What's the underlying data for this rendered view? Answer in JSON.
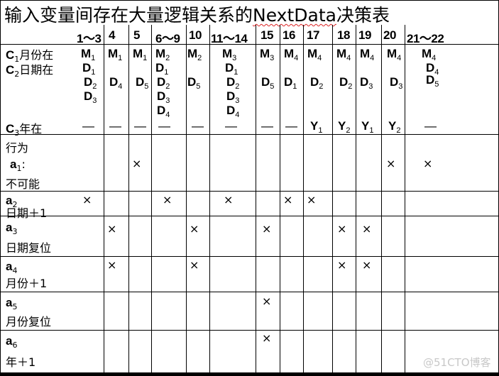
{
  "title": {
    "prefix": "输入变量间存在大量逻辑关系的",
    "keyword": "NextData",
    "suffix": "决策表"
  },
  "rules": [
    "1～3",
    "4",
    "5",
    "6～9",
    "10",
    "11～14",
    "15",
    "16",
    "17",
    "18",
    "19",
    "20",
    "21～22"
  ],
  "conditions": {
    "c1": {
      "id": "C",
      "sub": "1",
      "text": "月份在"
    },
    "c2": {
      "id": "C",
      "sub": "2",
      "text": "日期在"
    },
    "c3": {
      "id": "C",
      "sub": "3",
      "text": "年在"
    },
    "month": [
      [
        "M1"
      ],
      [
        "M1"
      ],
      [
        "M1"
      ],
      [
        "M2"
      ],
      [
        "M2"
      ],
      [
        "M3"
      ],
      [
        "M3"
      ],
      [
        "M4"
      ],
      [
        "M4"
      ],
      [
        "M4"
      ],
      [
        "M4"
      ],
      [
        "M4"
      ],
      [
        "M4"
      ]
    ],
    "day": [
      [
        "D1",
        "D2",
        "D3"
      ],
      [
        "D4"
      ],
      [
        "D5"
      ],
      [
        "D1",
        "D2",
        "D3",
        "D4"
      ],
      [
        "D5"
      ],
      [
        "D1",
        "D2",
        "D3",
        "D4"
      ],
      [
        "D5"
      ],
      [
        "D1"
      ],
      [
        "D2"
      ],
      [
        "D2"
      ],
      [
        "D3"
      ],
      [
        "D3"
      ],
      [
        "D4",
        "D5"
      ]
    ],
    "year": [
      "—",
      "—",
      "—",
      "—",
      "—",
      "—",
      "—",
      "—",
      "Y1",
      "Y2",
      "Y1",
      "Y2",
      "—"
    ]
  },
  "actions_header": "行为",
  "actions": [
    {
      "id": "a",
      "sub": "1",
      "text": "不可能",
      "suffix": ":",
      "marks": [
        false,
        false,
        true,
        false,
        false,
        false,
        false,
        false,
        false,
        false,
        false,
        true,
        true
      ]
    },
    {
      "id": "a",
      "sub": "2",
      "text": "日期＋1",
      "marks": [
        true,
        false,
        false,
        true,
        false,
        true,
        false,
        true,
        true,
        false,
        false,
        false,
        false
      ]
    },
    {
      "id": "a",
      "sub": "3",
      "text": "日期复位",
      "marks": [
        false,
        true,
        false,
        false,
        true,
        false,
        true,
        false,
        false,
        true,
        true,
        false,
        false
      ]
    },
    {
      "id": "a",
      "sub": "4",
      "text": "月份＋1",
      "marks": [
        false,
        true,
        false,
        false,
        true,
        false,
        false,
        false,
        false,
        true,
        true,
        false,
        false
      ]
    },
    {
      "id": "a",
      "sub": "5",
      "text": "月份复位",
      "marks": [
        false,
        false,
        false,
        false,
        false,
        false,
        true,
        false,
        false,
        false,
        false,
        false,
        false
      ]
    },
    {
      "id": "a",
      "sub": "6",
      "text": "年＋1",
      "marks": [
        false,
        false,
        false,
        false,
        false,
        false,
        true,
        false,
        false,
        false,
        false,
        false,
        false
      ]
    }
  ],
  "mark_symbol": "×",
  "watermark": "@51CTO博客"
}
